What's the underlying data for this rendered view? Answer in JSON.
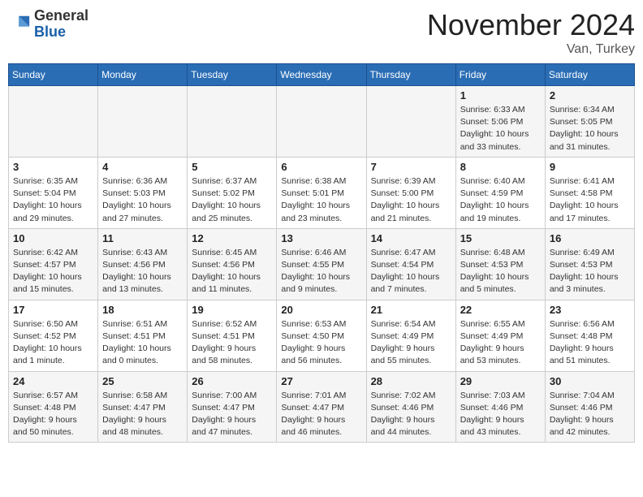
{
  "header": {
    "logo_line1": "General",
    "logo_line2": "Blue",
    "month": "November 2024",
    "location": "Van, Turkey"
  },
  "days_of_week": [
    "Sunday",
    "Monday",
    "Tuesday",
    "Wednesday",
    "Thursday",
    "Friday",
    "Saturday"
  ],
  "weeks": [
    [
      {
        "day": "",
        "info": ""
      },
      {
        "day": "",
        "info": ""
      },
      {
        "day": "",
        "info": ""
      },
      {
        "day": "",
        "info": ""
      },
      {
        "day": "",
        "info": ""
      },
      {
        "day": "1",
        "info": "Sunrise: 6:33 AM\nSunset: 5:06 PM\nDaylight: 10 hours and 33 minutes."
      },
      {
        "day": "2",
        "info": "Sunrise: 6:34 AM\nSunset: 5:05 PM\nDaylight: 10 hours and 31 minutes."
      }
    ],
    [
      {
        "day": "3",
        "info": "Sunrise: 6:35 AM\nSunset: 5:04 PM\nDaylight: 10 hours and 29 minutes."
      },
      {
        "day": "4",
        "info": "Sunrise: 6:36 AM\nSunset: 5:03 PM\nDaylight: 10 hours and 27 minutes."
      },
      {
        "day": "5",
        "info": "Sunrise: 6:37 AM\nSunset: 5:02 PM\nDaylight: 10 hours and 25 minutes."
      },
      {
        "day": "6",
        "info": "Sunrise: 6:38 AM\nSunset: 5:01 PM\nDaylight: 10 hours and 23 minutes."
      },
      {
        "day": "7",
        "info": "Sunrise: 6:39 AM\nSunset: 5:00 PM\nDaylight: 10 hours and 21 minutes."
      },
      {
        "day": "8",
        "info": "Sunrise: 6:40 AM\nSunset: 4:59 PM\nDaylight: 10 hours and 19 minutes."
      },
      {
        "day": "9",
        "info": "Sunrise: 6:41 AM\nSunset: 4:58 PM\nDaylight: 10 hours and 17 minutes."
      }
    ],
    [
      {
        "day": "10",
        "info": "Sunrise: 6:42 AM\nSunset: 4:57 PM\nDaylight: 10 hours and 15 minutes."
      },
      {
        "day": "11",
        "info": "Sunrise: 6:43 AM\nSunset: 4:56 PM\nDaylight: 10 hours and 13 minutes."
      },
      {
        "day": "12",
        "info": "Sunrise: 6:45 AM\nSunset: 4:56 PM\nDaylight: 10 hours and 11 minutes."
      },
      {
        "day": "13",
        "info": "Sunrise: 6:46 AM\nSunset: 4:55 PM\nDaylight: 10 hours and 9 minutes."
      },
      {
        "day": "14",
        "info": "Sunrise: 6:47 AM\nSunset: 4:54 PM\nDaylight: 10 hours and 7 minutes."
      },
      {
        "day": "15",
        "info": "Sunrise: 6:48 AM\nSunset: 4:53 PM\nDaylight: 10 hours and 5 minutes."
      },
      {
        "day": "16",
        "info": "Sunrise: 6:49 AM\nSunset: 4:53 PM\nDaylight: 10 hours and 3 minutes."
      }
    ],
    [
      {
        "day": "17",
        "info": "Sunrise: 6:50 AM\nSunset: 4:52 PM\nDaylight: 10 hours and 1 minute."
      },
      {
        "day": "18",
        "info": "Sunrise: 6:51 AM\nSunset: 4:51 PM\nDaylight: 10 hours and 0 minutes."
      },
      {
        "day": "19",
        "info": "Sunrise: 6:52 AM\nSunset: 4:51 PM\nDaylight: 9 hours and 58 minutes."
      },
      {
        "day": "20",
        "info": "Sunrise: 6:53 AM\nSunset: 4:50 PM\nDaylight: 9 hours and 56 minutes."
      },
      {
        "day": "21",
        "info": "Sunrise: 6:54 AM\nSunset: 4:49 PM\nDaylight: 9 hours and 55 minutes."
      },
      {
        "day": "22",
        "info": "Sunrise: 6:55 AM\nSunset: 4:49 PM\nDaylight: 9 hours and 53 minutes."
      },
      {
        "day": "23",
        "info": "Sunrise: 6:56 AM\nSunset: 4:48 PM\nDaylight: 9 hours and 51 minutes."
      }
    ],
    [
      {
        "day": "24",
        "info": "Sunrise: 6:57 AM\nSunset: 4:48 PM\nDaylight: 9 hours and 50 minutes."
      },
      {
        "day": "25",
        "info": "Sunrise: 6:58 AM\nSunset: 4:47 PM\nDaylight: 9 hours and 48 minutes."
      },
      {
        "day": "26",
        "info": "Sunrise: 7:00 AM\nSunset: 4:47 PM\nDaylight: 9 hours and 47 minutes."
      },
      {
        "day": "27",
        "info": "Sunrise: 7:01 AM\nSunset: 4:47 PM\nDaylight: 9 hours and 46 minutes."
      },
      {
        "day": "28",
        "info": "Sunrise: 7:02 AM\nSunset: 4:46 PM\nDaylight: 9 hours and 44 minutes."
      },
      {
        "day": "29",
        "info": "Sunrise: 7:03 AM\nSunset: 4:46 PM\nDaylight: 9 hours and 43 minutes."
      },
      {
        "day": "30",
        "info": "Sunrise: 7:04 AM\nSunset: 4:46 PM\nDaylight: 9 hours and 42 minutes."
      }
    ]
  ]
}
